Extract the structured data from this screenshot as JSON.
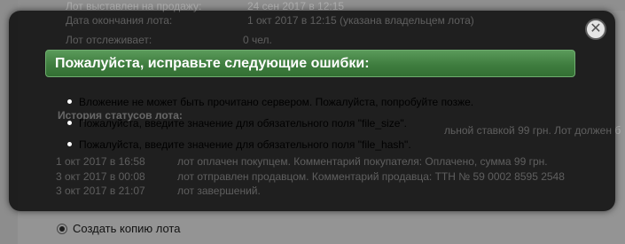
{
  "background": {
    "top_rows": [
      {
        "label": "Лот выставлен на продажу:",
        "value": "24 сен 2017 в 12:15"
      },
      {
        "label": "Дата окончания лота:",
        "value": "1 окт 2017 в 12:15 (указана владельцем лота)"
      },
      {
        "label": "Лот отслеживает:",
        "value": "0 чел."
      }
    ],
    "history_title": "История статусов лота:",
    "history_fragment": "льной ставкой 99 грн. Лот должен б",
    "history_rows": [
      {
        "date": "1 окт 2017 в 16:58",
        "text": "лот оплачен покупцем. Комментарий покупателя: Оплачено, сумма 99 грн."
      },
      {
        "date": "3 окт 2017 в 00:08",
        "text": "лот отправлен продавцом. Комментарий продавца: ТТН № 59 0002 8595 2548"
      },
      {
        "date": "3 окт 2017 в 21:07",
        "text": "лот завершений."
      }
    ],
    "copy_lot_label": "Создать копию лота"
  },
  "modal": {
    "title": "Пожалуйста, исправьте следующие ошибки:",
    "errors": [
      "Вложение не может быть прочитано сервером. Пожалуйста, попробуйте позже.",
      "Пожалуйста, введите значение для обязательного поля \"file_size\".",
      "Пожалуйста, введите значение для обязательного поля \"file_hash\"."
    ],
    "close_symbol": "✕"
  },
  "colors": {
    "header_green": "#3f7d3f",
    "modal_background": "#080808",
    "close_button": "#e4e4e4"
  }
}
